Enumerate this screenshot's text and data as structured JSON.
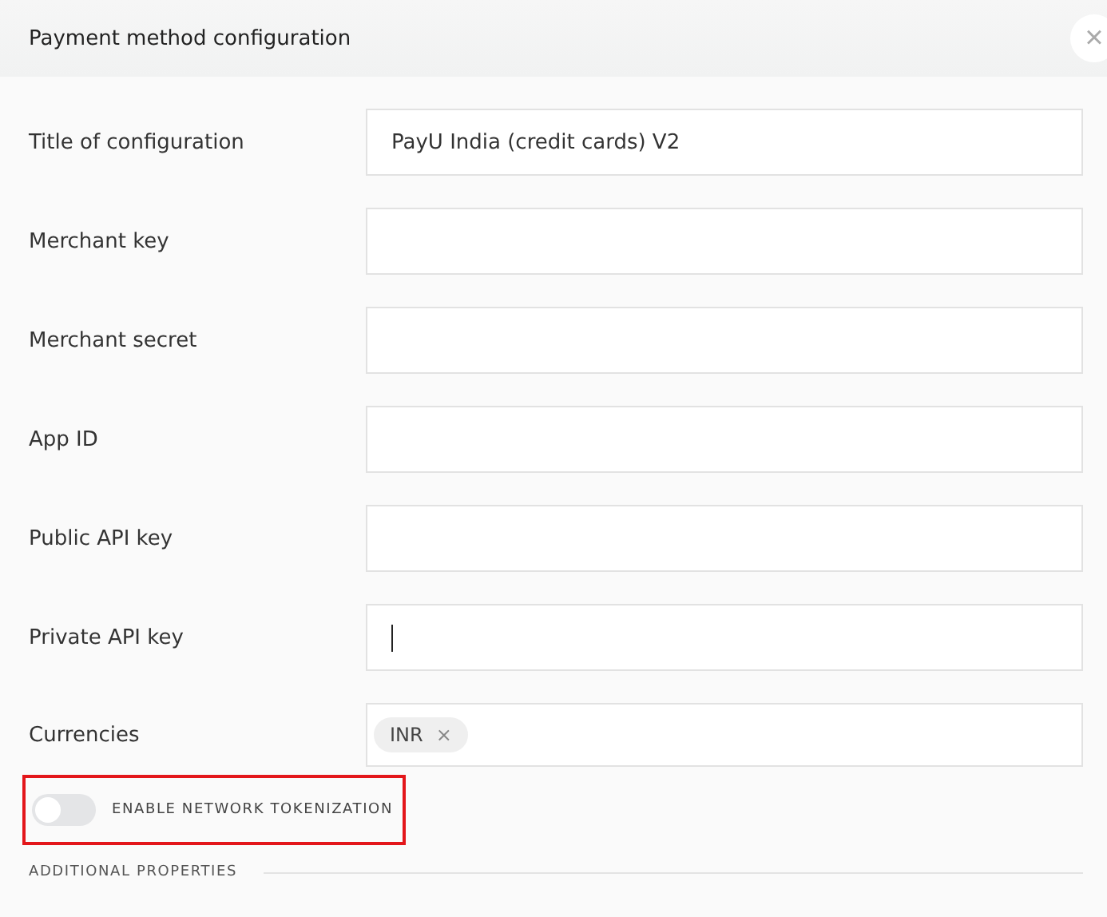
{
  "dialog": {
    "title": "Payment method configuration",
    "close": "×"
  },
  "fields": [
    {
      "label": "Title of configuration",
      "value": "PayU India (credit cards) V2",
      "focused": false
    },
    {
      "label": "Merchant key",
      "focused": false
    },
    {
      "label": "Merchant secret",
      "focused": false
    },
    {
      "label": "App ID",
      "focused": false
    },
    {
      "label": "Public API key",
      "focused": false
    },
    {
      "label": "Private API key",
      "focused": true
    }
  ],
  "currencies": {
    "label": "Currencies",
    "tags": [
      {
        "text": "INR",
        "remove": "×"
      }
    ]
  },
  "toggle": {
    "label": "ENABLE NETWORK TOKENIZATION",
    "on": false,
    "highlighted": true
  },
  "section": {
    "title": "ADDITIONAL PROPERTIES"
  }
}
